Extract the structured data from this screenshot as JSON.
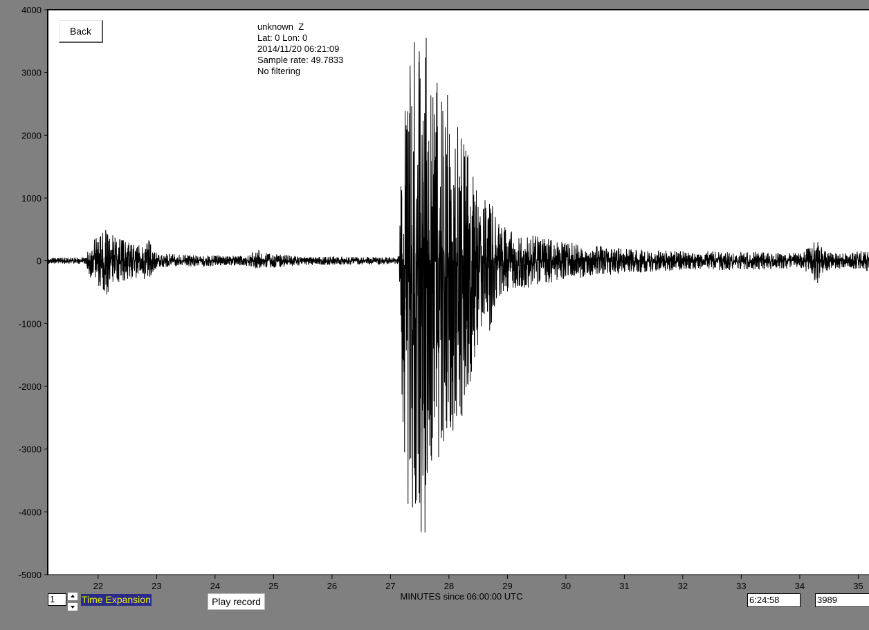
{
  "controls": {
    "back_label": "Back",
    "expansion_value": "1",
    "time_expansion_label": "Time Expansion",
    "play_label": "Play record",
    "cursor_time": "6:24:58",
    "cursor_value": "3989"
  },
  "info": {
    "station": "unknown  Z",
    "location": "Lat: 0 Lon: 0",
    "datetime": "2014/11/20 06:21:09",
    "sample_rate": "Sample rate: 49.7833",
    "filter": "No filtering"
  },
  "chart_data": {
    "type": "line",
    "title": "",
    "xlabel": "MINUTES since 06:00:00 UTC",
    "ylabel": "",
    "xlim": [
      21.15,
      35.35
    ],
    "ylim": [
      -5000,
      4000
    ],
    "yticks": [
      "4000",
      "3000",
      "2000",
      "1000",
      "0",
      "-1000",
      "-2000",
      "-3000",
      "-4000",
      "-5000"
    ],
    "xticks": [
      "22",
      "23",
      "24",
      "25",
      "26",
      "27",
      "28",
      "29",
      "30",
      "31",
      "32",
      "33",
      "34",
      "35"
    ],
    "grid": false,
    "series": [
      {
        "line_color": "#000000",
        "envelope_x": [
          21.15,
          21.8,
          21.85,
          22.0,
          22.15,
          22.3,
          22.5,
          22.7,
          22.85,
          23.0,
          23.5,
          24.0,
          24.5,
          24.75,
          24.9,
          25.5,
          26.0,
          26.5,
          27.0,
          27.15,
          27.2,
          27.3,
          27.45,
          27.55,
          27.65,
          27.8,
          28.0,
          28.2,
          28.4,
          28.6,
          28.7,
          28.8,
          29.0,
          29.5,
          30.0,
          31.0,
          32.0,
          33.0,
          34.0,
          34.2,
          34.3,
          34.4,
          34.6,
          35.35
        ],
        "envelope_max": [
          50,
          50,
          300,
          380,
          520,
          380,
          320,
          250,
          350,
          120,
          100,
          90,
          80,
          180,
          120,
          70,
          70,
          60,
          60,
          80,
          2400,
          3500,
          3600,
          4000,
          3300,
          3100,
          2600,
          2000,
          1500,
          1000,
          1050,
          700,
          500,
          400,
          300,
          200,
          150,
          150,
          120,
          250,
          380,
          200,
          120,
          180
        ],
        "envelope_min": [
          -50,
          -50,
          -300,
          -400,
          -550,
          -400,
          -330,
          -280,
          -300,
          -120,
          -100,
          -90,
          -80,
          -150,
          -120,
          -70,
          -70,
          -60,
          -60,
          -80,
          -2600,
          -3900,
          -4100,
          -4700,
          -3800,
          -3300,
          -2900,
          -2600,
          -1800,
          -1100,
          -1200,
          -700,
          -500,
          -400,
          -300,
          -200,
          -150,
          -150,
          -120,
          -250,
          -400,
          -200,
          -120,
          -180
        ]
      }
    ]
  }
}
